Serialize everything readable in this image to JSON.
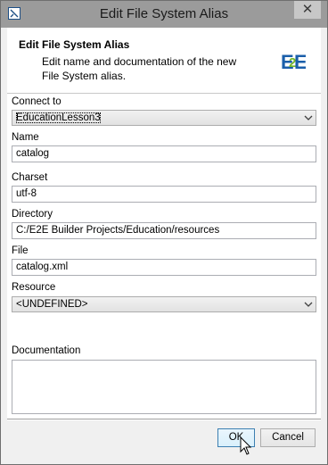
{
  "window": {
    "title": "Edit File System Alias",
    "close_glyph": "✕"
  },
  "header": {
    "title": "Edit File System Alias",
    "description": "Edit name and documentation of the new File System alias.",
    "logo_text": "E2E",
    "logo_colors": {
      "blue": "#1b5faa",
      "green": "#76b82a"
    }
  },
  "form": {
    "connect_to": {
      "label": "Connect to",
      "value": "EducationLesson3"
    },
    "name": {
      "label": "Name",
      "value": "catalog"
    },
    "charset": {
      "label": "Charset",
      "value": "utf-8"
    },
    "directory": {
      "label": "Directory",
      "value": "C:/E2E Builder Projects/Education/resources"
    },
    "file": {
      "label": "File",
      "value": "catalog.xml"
    },
    "resource": {
      "label": "Resource",
      "value": "<UNDEFINED>"
    },
    "documentation": {
      "label": "Documentation",
      "value": ""
    }
  },
  "buttons": {
    "ok": "OK",
    "cancel": "Cancel"
  }
}
